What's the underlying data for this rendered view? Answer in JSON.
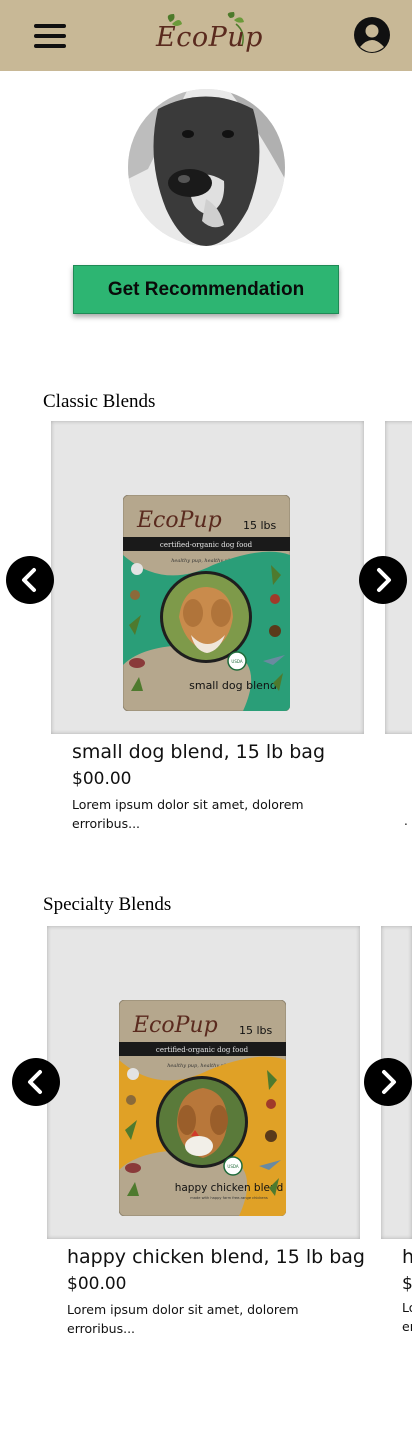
{
  "header": {
    "menu_icon": "hamburger-menu-icon",
    "logo_text": "EcoPup",
    "account_icon": "account-circle-icon",
    "colors": {
      "bar": "#c8b896",
      "logo": "#5a2a1e"
    }
  },
  "hero": {
    "avatar_alt": "dog photo",
    "button_label": "Get Recommendation",
    "button_color": "#2db572"
  },
  "sections": [
    {
      "title": "Classic Blends",
      "products": [
        {
          "name": "small dog blend, 15 lb bag",
          "price": "$00.00",
          "description": "Lorem ipsum dolor sit amet, dolorem erroribus...",
          "bag": {
            "brand": "EcoPup",
            "weight": "15 lbs",
            "tagline": "certified-organic dog food",
            "subtag": "healthy pup, healthy planet",
            "blend": "small dog blend",
            "badge": "USDA ORGANIC",
            "accent": "#2a9e78"
          }
        }
      ],
      "peek_price": "",
      "peek_desc": "."
    },
    {
      "title": "Specialty Blends",
      "products": [
        {
          "name": "happy chicken blend, 15 lb bag",
          "price": "$00.00",
          "description": "Lorem ipsum dolor sit amet, dolorem erroribus...",
          "bag": {
            "brand": "EcoPup",
            "weight": "15 lbs",
            "tagline": "certified-organic dog food",
            "subtag": "healthy pup, healthy planet",
            "blend": "happy chicken blend",
            "blend_sub": "made with happy farm free-range chickens",
            "badge": "USDA ORGANIC",
            "accent": "#e0a126"
          }
        }
      ],
      "peek_name": "h",
      "peek_price": "$",
      "peek_desc_1": "Lo",
      "peek_desc_2": "er"
    }
  ],
  "arrows": {
    "prev_icon": "chevron-left-icon",
    "next_icon": "chevron-right-icon"
  }
}
